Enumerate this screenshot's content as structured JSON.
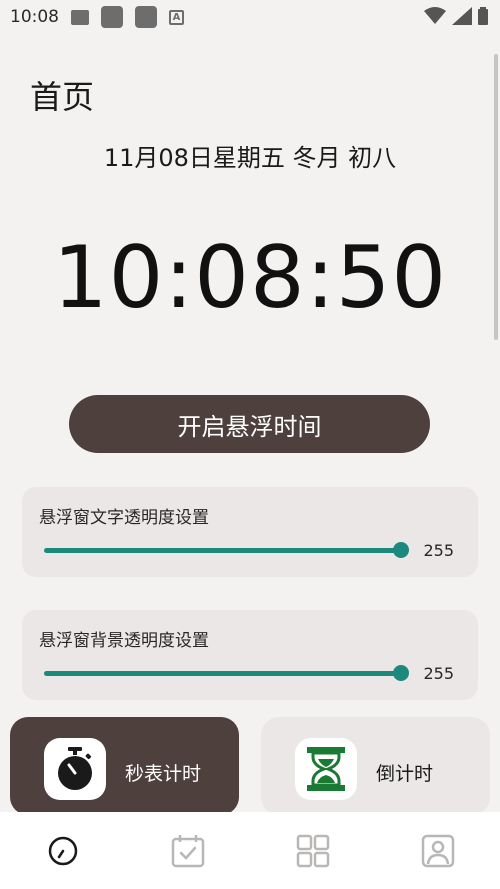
{
  "status_bar": {
    "time": "10:08"
  },
  "page": {
    "title": "首页"
  },
  "date_line": "11月08日星期五  冬月 初八",
  "clock": "10:08:50",
  "float_button": {
    "label": "开启悬浮时间"
  },
  "settings": [
    {
      "title": "悬浮窗文字透明度设置",
      "value": "255"
    },
    {
      "title": "悬浮窗背景透明度设置",
      "value": "255"
    }
  ],
  "tiles": {
    "stopwatch": {
      "label": "秒表计时",
      "icon": "stopwatch-icon"
    },
    "countdown": {
      "label": "倒计时",
      "icon": "hourglass-icon"
    }
  },
  "bottom_nav": [
    {
      "icon": "clock-icon",
      "active": true
    },
    {
      "icon": "calendar-check-icon",
      "active": false
    },
    {
      "icon": "grid-icon",
      "active": false
    },
    {
      "icon": "profile-icon",
      "active": false
    }
  ],
  "colors": {
    "accent": "#1b8a7c",
    "primary": "#4e403d",
    "background": "#f4f2f1",
    "card": "#ebe7e6"
  }
}
